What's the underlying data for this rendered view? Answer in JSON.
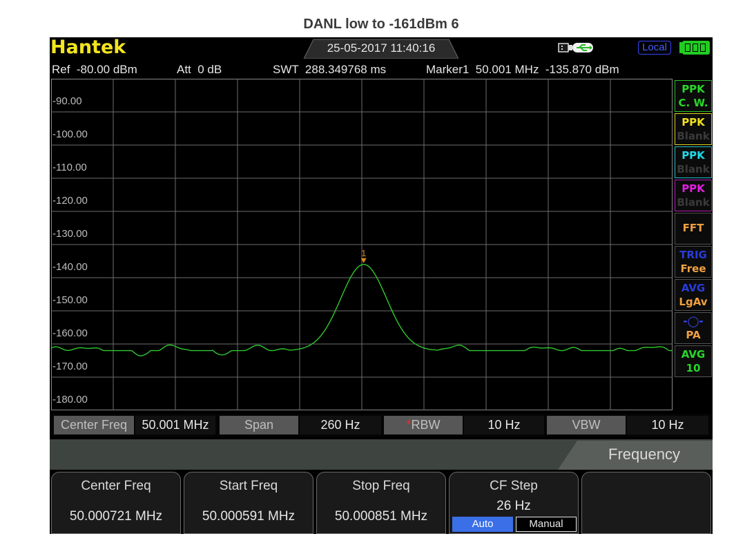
{
  "caption": "DANL low to -161dBm 6",
  "topbar": {
    "brand": "Hantek",
    "datetime": "25-05-2017 11:40:16",
    "usb_icon": "usb-plug-icon",
    "local_label": "Local",
    "battery_icon": "battery-full-icon"
  },
  "info": {
    "ref": "Ref  -80.00 dBm",
    "att": "Att  0 dB",
    "swt": "SWT  288.349768 ms",
    "marker": "Marker1  50.001 MHz  -135.870 dBm"
  },
  "plot": {
    "y_labels": [
      "-90.00",
      "-100.00",
      "-110.00",
      "-120.00",
      "-130.00",
      "-140.00",
      "-150.00",
      "-160.00",
      "-170.00",
      "-180.00"
    ],
    "marker_label": "1",
    "trace_color": "#2fc82f",
    "marker_color": "#d98a1a"
  },
  "side_tags": [
    {
      "l1": "PPK",
      "l2": "C. W.",
      "c1": "#28d828",
      "c2": "#28d828",
      "border": "#28c828"
    },
    {
      "l1": "PPK",
      "l2": "Blank",
      "c1": "#f0e020",
      "c2": "#3a3a3a",
      "border": "#e6d81e"
    },
    {
      "l1": "PPK",
      "l2": "Blank",
      "c1": "#22d8e8",
      "c2": "#3a3a3a",
      "border": "#22c8d8"
    },
    {
      "l1": "PPK",
      "l2": "Blank",
      "c1": "#e020e0",
      "c2": "#3a3a3a",
      "border": "#c020c0"
    },
    {
      "l1": "FFT",
      "l2": "",
      "c1": "#f0a040",
      "c2": "#f0a040",
      "border": "#555555"
    },
    {
      "l1": "TRIG",
      "l2": "Free",
      "c1": "#2a3cd8",
      "c2": "#f0a040",
      "border": "#555555"
    },
    {
      "l1": "AVG",
      "l2": "LgAv",
      "c1": "#2a3cd8",
      "c2": "#f0a040",
      "border": "#555555"
    },
    {
      "l1": "-◯-",
      "l2": "PA",
      "c1": "#3a4cff",
      "c2": "#f0a040",
      "border": "#555555"
    },
    {
      "l1": "AVG",
      "l2": "10",
      "c1": "#28d828",
      "c2": "#28d828",
      "border": "#555555"
    }
  ],
  "params": {
    "center_label": "Center Freq",
    "center_value": "50.001 MHz",
    "span_label": "Span",
    "span_value": "260 Hz",
    "rbw_star": "*",
    "rbw_label": "RBW",
    "rbw_value": "10 Hz",
    "vbw_label": "VBW",
    "vbw_value": "10 Hz"
  },
  "menu": {
    "title": "Frequency"
  },
  "softkeys": [
    {
      "title": "Center Freq",
      "value": "50.000721 MHz"
    },
    {
      "title": "Start Freq",
      "value": "50.000591 MHz"
    },
    {
      "title": "Stop Freq",
      "value": "50.000851 MHz"
    },
    {
      "title": "CF Step",
      "value": "26 Hz",
      "opt_on": "Auto",
      "opt_off": "Manual"
    },
    {
      "title": "",
      "value": ""
    }
  ]
}
